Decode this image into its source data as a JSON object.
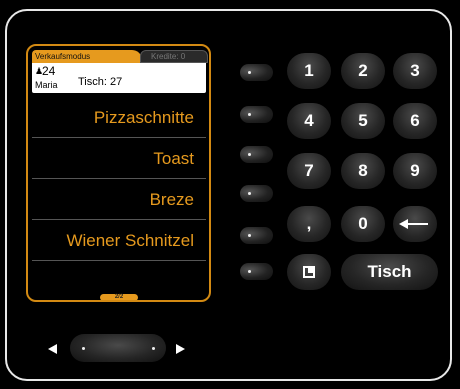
{
  "tabs": {
    "active": "Verkaufsmodus",
    "inactive": "Kredite: 0"
  },
  "info": {
    "person_icon": "person-icon",
    "guests": "24",
    "waiter": "Maria",
    "table": "Tisch: 27"
  },
  "items": [
    "Pizzaschnitte",
    "Toast",
    "Breze",
    "Wiener Schnitzel"
  ],
  "pager": "2/2",
  "keypad": {
    "k1": "1",
    "k2": "2",
    "k3": "3",
    "k4": "4",
    "k5": "5",
    "k6": "6",
    "k7": "7",
    "k8": "8",
    "k9": "9",
    "comma": ",",
    "k0": "0",
    "tisch": "Tisch"
  },
  "colors": {
    "accent": "#e69a1e",
    "background": "#000000",
    "frame": "#e8e8e8"
  }
}
